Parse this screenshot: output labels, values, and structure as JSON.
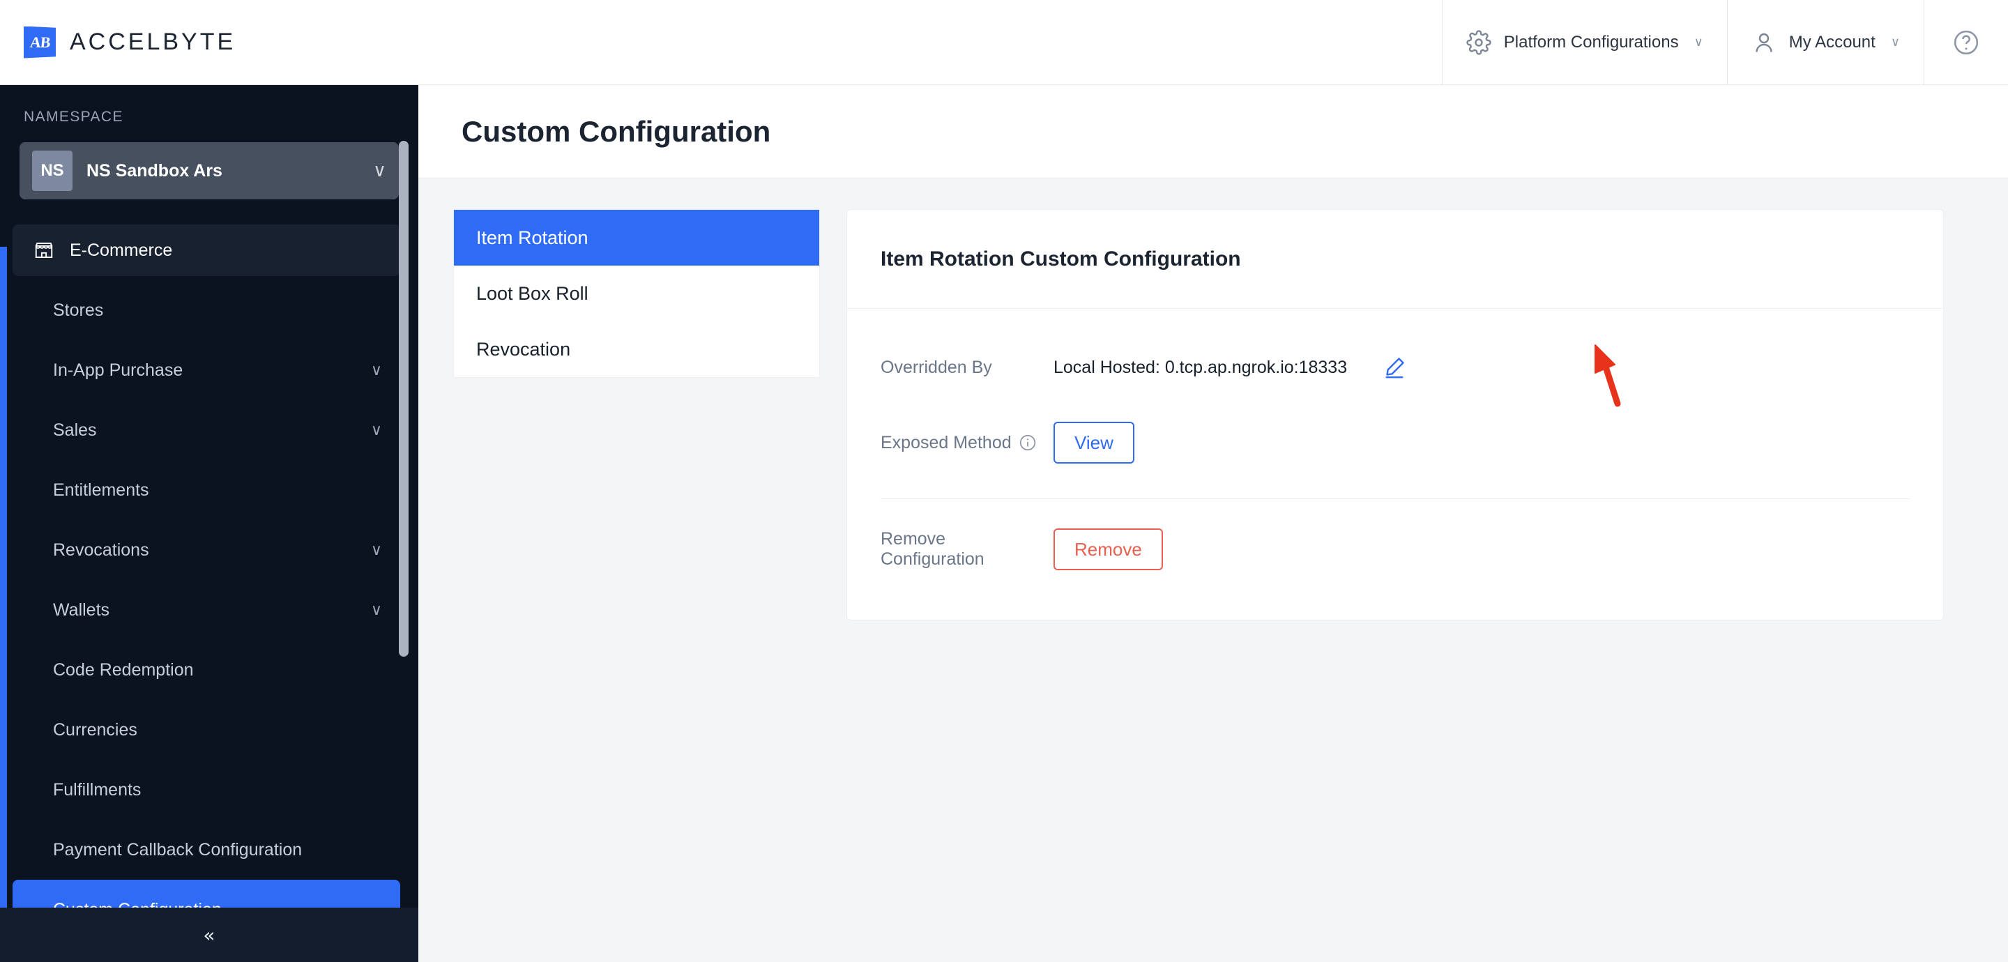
{
  "header": {
    "brand_name": "ACCELBYTE",
    "logo_text": "AB",
    "items": [
      {
        "label": "Platform Configurations",
        "icon": "gear-icon",
        "caret": "∨"
      },
      {
        "label": "My Account",
        "icon": "user-icon",
        "caret": "∨"
      }
    ],
    "help_icon": "question-circle-icon"
  },
  "sidebar": {
    "namespace_label": "NAMESPACE",
    "namespace": {
      "badge": "NS",
      "name": "NS Sandbox Ars",
      "caret": "∨"
    },
    "group": {
      "label": "E-Commerce",
      "icon": "storefront-icon"
    },
    "items": [
      {
        "label": "Stores",
        "expandable": false
      },
      {
        "label": "In-App Purchase",
        "expandable": true,
        "chevron": "∨"
      },
      {
        "label": "Sales",
        "expandable": true,
        "chevron": "∨"
      },
      {
        "label": "Entitlements",
        "expandable": false
      },
      {
        "label": "Revocations",
        "expandable": true,
        "chevron": "∨"
      },
      {
        "label": "Wallets",
        "expandable": true,
        "chevron": "∨"
      },
      {
        "label": "Code Redemption",
        "expandable": false
      },
      {
        "label": "Currencies",
        "expandable": false
      },
      {
        "label": "Fulfillments",
        "expandable": false
      },
      {
        "label": "Payment Callback Configuration",
        "expandable": false
      },
      {
        "label": "Custom Configuration",
        "expandable": false,
        "active": true
      }
    ],
    "collapse_glyph": "«"
  },
  "main": {
    "page_title": "Custom Configuration",
    "tabs": [
      {
        "label": "Item Rotation",
        "active": true
      },
      {
        "label": "Loot Box Roll",
        "active": false
      },
      {
        "label": "Revocation",
        "active": false
      }
    ],
    "card": {
      "title": "Item Rotation Custom Configuration",
      "overridden_by_label": "Overridden By",
      "overridden_by_value": "Local Hosted: 0.tcp.ap.ngrok.io:18333",
      "edit_icon": "pencil-edit-icon",
      "exposed_method_label": "Exposed Method",
      "exposed_method_info_icon": "info-circle-icon",
      "view_button": "View",
      "remove_label": "Remove Configuration",
      "remove_button": "Remove"
    }
  },
  "colors": {
    "accent_blue": "#2f6bf5",
    "sidebar_bg": "#0b1220",
    "danger_red": "#e8604f",
    "annotation_red": "#e8331c",
    "canvas": "#f3f5f7"
  }
}
